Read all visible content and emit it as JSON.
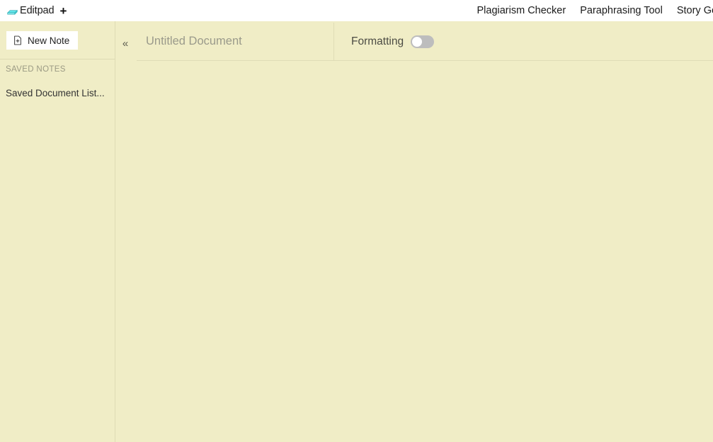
{
  "header": {
    "brand_name": "Editpad",
    "brand_logo_icon": "notepad-icon",
    "brand_logo_color": "#5FE3E8",
    "new_tab_plus": "+",
    "nav_links": [
      {
        "label": "Plagiarism Checker"
      },
      {
        "label": "Paraphrasing Tool"
      },
      {
        "label": "Story Generator"
      }
    ]
  },
  "sidebar": {
    "new_note_label": "New Note",
    "new_note_icon": "file-plus-icon",
    "section_label": "SAVED NOTES",
    "saved_items": [
      {
        "label": "Saved Document List..."
      }
    ]
  },
  "rail": {
    "collapse_icon": "chevron-double-left-icon",
    "collapse_glyph": "«"
  },
  "editor": {
    "title_value": "",
    "title_placeholder": "Untitled Document",
    "formatting_label": "Formatting",
    "formatting_enabled": false,
    "content_value": "",
    "content_placeholder": ""
  },
  "colors": {
    "page_background": "#F0EDC6",
    "header_background": "#FFFFFF",
    "border": "#DEDBB4",
    "muted_text": "#9b9a84",
    "body_text": "#333333",
    "toggle_off_track": "#BDBDBD",
    "toggle_knob": "#FFFFFF"
  }
}
